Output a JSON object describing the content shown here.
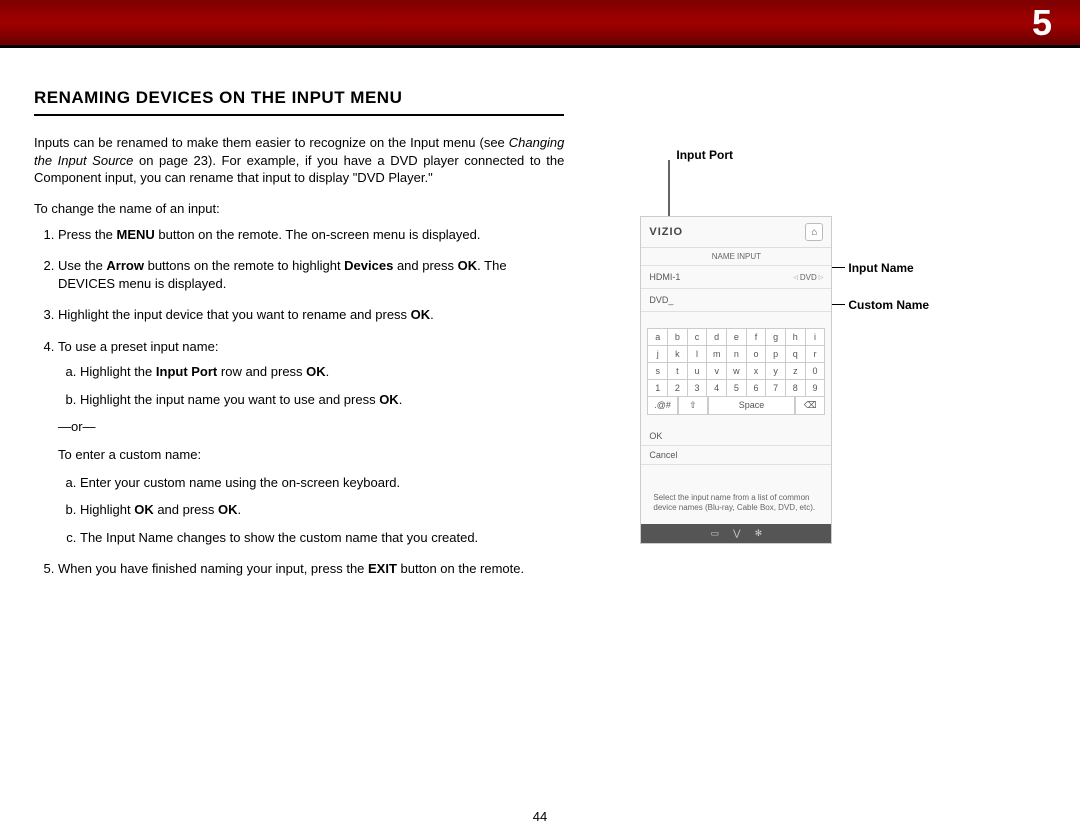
{
  "chapter": "5",
  "heading": "RENAMING DEVICES ON THE INPUT MENU",
  "intro_parts": {
    "a": "Inputs can be renamed to make them easier to recognize  on the Input menu (see ",
    "b": "Changing the Input Source",
    "c": " on page 23). For example, if you have a DVD player connected to the Component input, you can rename that input to display \"DVD Player.\""
  },
  "lead": "To change the name of an input:",
  "steps": {
    "s1a": "Press the ",
    "s1b": "MENU",
    "s1c": " button on the remote. The on-screen menu is displayed.",
    "s2a": "Use the ",
    "s2b": "Arrow",
    "s2c": " buttons on the remote to highlight ",
    "s2d": "Devices",
    "s2e": " and press ",
    "s2f": "OK",
    "s2g": ". The DEVICES menu is displayed.",
    "s3a": "Highlight the input device that you want to rename and press ",
    "s3b": "OK",
    "s3c": ".",
    "s4": "To use a preset input name:",
    "s4aa": "Highlight the ",
    "s4ab": "Input Port",
    "s4ac": " row and press ",
    "s4ad": "OK",
    "s4ae": ".",
    "s4ba": "Highlight the input name you want to use and press ",
    "s4bb": "OK",
    "s4bc": ".",
    "or": "—or—",
    "custom_lead": "To enter a custom name:",
    "ca": "Enter your custom name using the on-screen keyboard.",
    "cba": "Highlight ",
    "cbb": "OK",
    "cbc": " and press ",
    "cbd": "OK",
    "cbe": ".",
    "cc": "The Input Name changes to show the custom name that you created.",
    "s5a": "When you have finished naming your input, press the ",
    "s5b": "EXIT",
    "s5c": " button on the remote."
  },
  "callouts": {
    "port": "Input Port",
    "name": "Input Name",
    "custom": "Custom Name"
  },
  "osd": {
    "brand": "VIZIO",
    "title": "NAME INPUT",
    "port_label": "HDMI-1",
    "port_value": "DVD",
    "custom_value": "DVD_",
    "keys_rows": [
      [
        "a",
        "b",
        "c",
        "d",
        "e",
        "f",
        "g",
        "h",
        "i"
      ],
      [
        "j",
        "k",
        "l",
        "m",
        "n",
        "o",
        "p",
        "q",
        "r"
      ],
      [
        "s",
        "t",
        "u",
        "v",
        "w",
        "x",
        "y",
        "z",
        "0"
      ],
      [
        "1",
        "2",
        "3",
        "4",
        "5",
        "6",
        "7",
        "8",
        "9"
      ]
    ],
    "sym": ".@#",
    "shift": "⇧",
    "space": "Space",
    "del": "⌫",
    "ok": "OK",
    "cancel": "Cancel",
    "help": "Select the input name from a list of common device names (Blu-ray, Cable Box, DVD, etc).",
    "footer_icons": [
      "▭",
      "⋁",
      "✻"
    ]
  },
  "page_number": "44"
}
